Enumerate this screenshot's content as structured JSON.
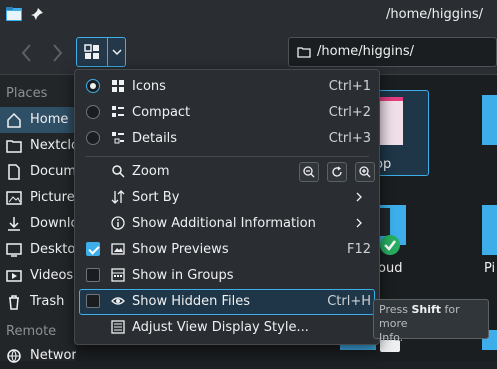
{
  "window": {
    "title": "/home/higgins/"
  },
  "toolbar": {
    "address": "/home/higgins/"
  },
  "sidebar": {
    "places_header": "Places",
    "items": [
      {
        "label": "Home"
      },
      {
        "label": "Nextcloud"
      },
      {
        "label": "Documents"
      },
      {
        "label": "Pictures"
      },
      {
        "label": "Downloads"
      },
      {
        "label": "Desktop"
      },
      {
        "label": "Videos"
      },
      {
        "label": "Trash"
      }
    ],
    "remote_header": "Remote",
    "remote_items": [
      {
        "label": "Network"
      }
    ]
  },
  "content": {
    "files": [
      {
        "label": "op"
      },
      {
        "label": "oud"
      },
      {
        "label": "Pi"
      }
    ]
  },
  "menu": {
    "items": [
      {
        "label": "Icons",
        "shortcut": "Ctrl+1"
      },
      {
        "label": "Compact",
        "shortcut": "Ctrl+2"
      },
      {
        "label": "Details",
        "shortcut": "Ctrl+3"
      },
      {
        "label": "Zoom"
      },
      {
        "label": "Sort By"
      },
      {
        "label": "Show Additional Information"
      },
      {
        "label": "Show Previews",
        "shortcut": "F12"
      },
      {
        "label": "Show in Groups"
      },
      {
        "label": "Show Hidden Files",
        "shortcut": "Ctrl+H"
      },
      {
        "label": "Adjust View Display Style..."
      }
    ]
  },
  "tooltip": {
    "pre": "Press ",
    "key": "Shift",
    "post": " for more",
    "line2": "Info."
  },
  "colors": {
    "accent": "#3daee9",
    "background": "#1d2024",
    "menu": "#2a2e32"
  }
}
